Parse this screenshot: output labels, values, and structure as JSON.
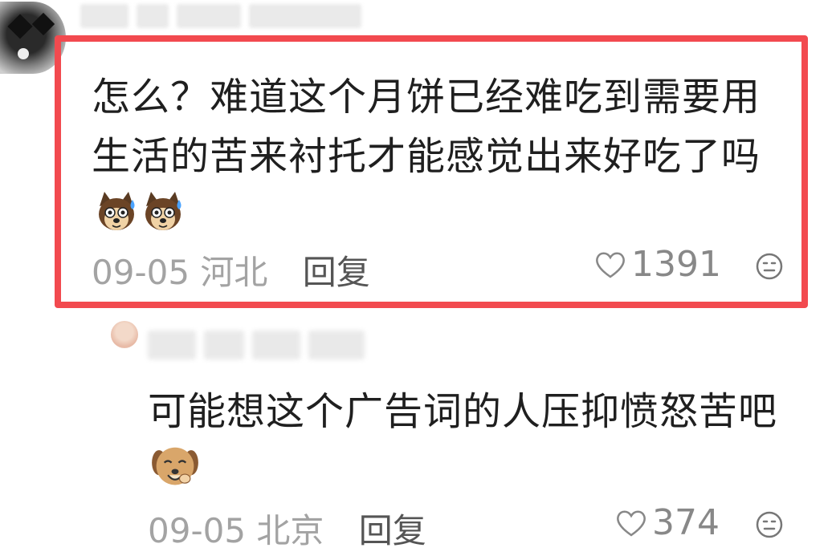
{
  "comment": {
    "text": "怎么？难道这个月饼已经难吃到需要用生活的苦来衬托才能感觉出来好吃了吗",
    "date": "09-05",
    "location": "河北",
    "reply_label": "回复",
    "likes": "1391",
    "emojis": [
      "dog-sweat-icon",
      "dog-sweat-icon"
    ]
  },
  "reply_comment": {
    "text": "可能想这个广告词的人压抑愤怒苦吧",
    "date": "09-05",
    "location": "北京",
    "reply_label": "回复",
    "likes": "374",
    "emojis": [
      "dog-laugh-icon"
    ]
  },
  "colors": {
    "highlight_border": "#f24a4f",
    "meta_text": "#a3a3a3",
    "body_text": "#1f1f1f"
  }
}
